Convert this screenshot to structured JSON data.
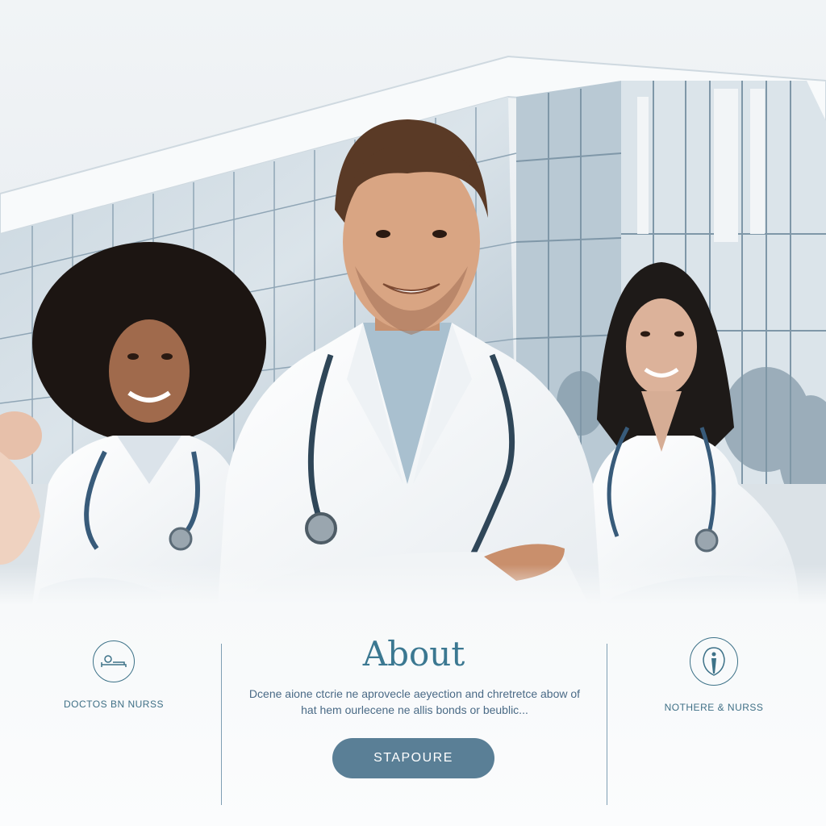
{
  "about": {
    "title": "About",
    "body": "Dcene aione ctcrie ne aprovecle aeyection and chretretce abow of hat hem ourlecene ne allis bonds or beublic...",
    "button_label": "STAPOURE"
  },
  "features": [
    {
      "label": "Doctos Bn nurss",
      "icon": "bed-icon"
    },
    {
      "label": "Nothere & nurss",
      "icon": "person-icon"
    }
  ],
  "colors": {
    "accent": "#3b7891",
    "button": "#5a7f96",
    "divider": "#7f9fb4"
  }
}
